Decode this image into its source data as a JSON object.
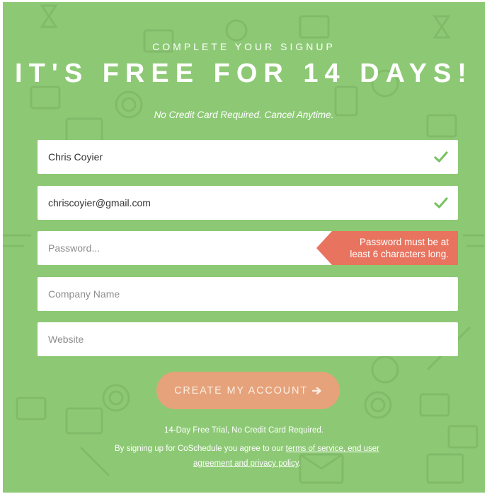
{
  "colors": {
    "background": "#8dc975",
    "error": "#e8735f",
    "cta": "#e6a27a",
    "check": "#7cc264"
  },
  "header": {
    "eyebrow": "COMPLETE YOUR SIGNUP",
    "headline": "IT'S FREE FOR 14 DAYS!",
    "subline": "No Credit Card Required. Cancel Anytime."
  },
  "form": {
    "name": {
      "value": "Chris Coyier",
      "placeholder": "",
      "status_icon": "checkmark-icon"
    },
    "email": {
      "value": "chriscoyier@gmail.com",
      "placeholder": "",
      "status_icon": "checkmark-icon"
    },
    "password": {
      "value": "",
      "placeholder": "Password...",
      "error_line1": "Password must be at",
      "error_line2": "least 6 characters long."
    },
    "company": {
      "value": "",
      "placeholder": "Company Name"
    },
    "website": {
      "value": "",
      "placeholder": "Website"
    },
    "submit_label": "CREATE MY ACCOUNT",
    "submit_icon": "arrow-right-icon"
  },
  "footer": {
    "trial_text": "14-Day Free Trial, No Credit Card Required.",
    "agree_prefix": "By signing up for CoSchedule you agree to our ",
    "terms_link": "terms of service, end user agreement and privacy policy",
    "agree_suffix": "."
  }
}
